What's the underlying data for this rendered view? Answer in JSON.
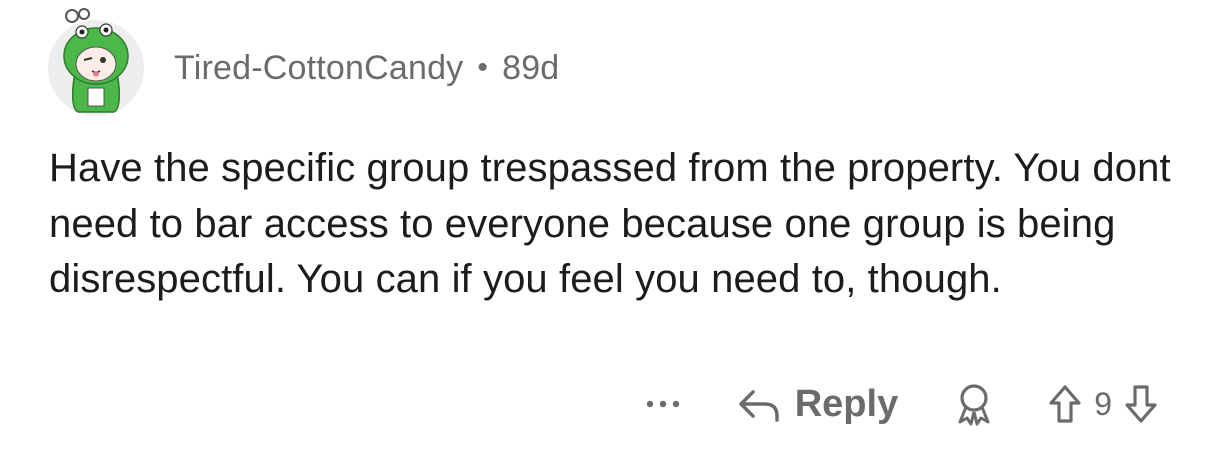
{
  "comment": {
    "username": "Tired-CottonCandy",
    "separator": "•",
    "age": "89d",
    "avatar": "frog-hood-avatar",
    "body": "Have the specific group trespassed from the property. You dont need to bar access to everyone because one group is being disrespectful. You can if you feel you need to, though.",
    "actions": {
      "more_icon": "more-dots-icon",
      "reply_icon": "reply-arrow-icon",
      "reply_label": "Reply",
      "award_icon": "award-icon",
      "upvote_icon": "upvote-arrow-icon",
      "score": "9",
      "downvote_icon": "downvote-arrow-icon"
    }
  },
  "colors": {
    "meta_text": "#6b6b6b",
    "body_text": "#1c1c1c",
    "background": "#ffffff",
    "avatar_bg": "#eeeeee",
    "avatar_green": "#4cb84a"
  }
}
